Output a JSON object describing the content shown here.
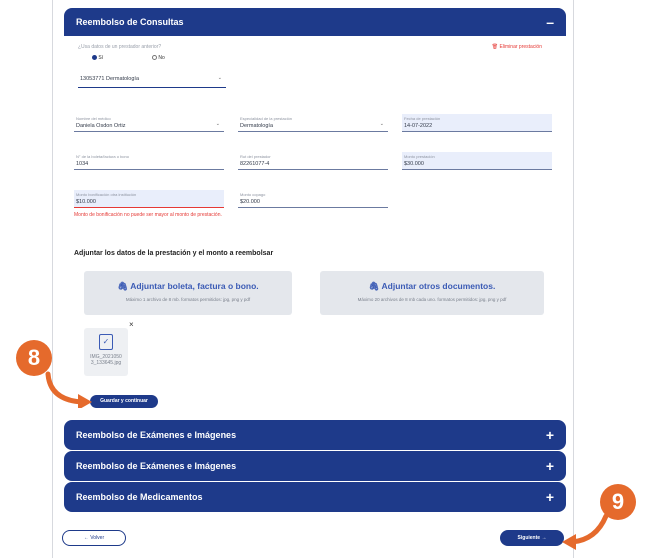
{
  "accordions": {
    "consultas": {
      "title": "Reembolso de Consultas",
      "sign": "–"
    },
    "examenes1": {
      "title": "Reembolso de Exámenes e Imágenes",
      "sign": "+"
    },
    "examenes2": {
      "title": "Reembolso de Exámenes e Imágenes",
      "sign": "+"
    },
    "medicamentos": {
      "title": "Reembolso de Medicamentos",
      "sign": "+"
    }
  },
  "form": {
    "question": "¿Usa datos de un prestador anterior?",
    "delete_link": "Eliminar prestación",
    "radio_yes": "Sí",
    "radio_no": "No",
    "prestador_select": "13053771 Dermatología",
    "fields": {
      "medico_label": "Nombre del médico",
      "medico_value": "Daniela Osdon Ortiz",
      "especialidad_label": "Especialidad de la prestación",
      "especialidad_value": "Dermatología",
      "fecha_label": "Fecha de prestación",
      "fecha_value": "14-07-2022",
      "boleta_label": "N° de la boleta/factura o bono",
      "boleta_value": "1034",
      "rut_label": "Rut del prestador",
      "rut_value": "82261077-4",
      "monto_label": "Monto prestación",
      "monto_value": "$30.000",
      "bonificacion_label": "Monto bonificación otra institución",
      "bonificacion_value": "$10.000",
      "copago_label": "Monto copago",
      "copago_value": "$20.000"
    },
    "error_text": "Monto de bonificación no puede ser mayor al monto de prestación."
  },
  "upload": {
    "section_title": "Adjuntar los datos de la prestación y el monto a reembolsar",
    "boleta_title": "Adjuntar boleta, factura o bono.",
    "boleta_sub": "Máximo 1 archivo de 8 mb. formatos permitidos: jpg, png y pdf",
    "otros_title": "Adjuntar otros documentos.",
    "otros_sub": "Máximo 20 archivos de 8 mb cada uno. formatos permitidos: jpg, png y pdf",
    "file_name_1": "IMG_2021050",
    "file_name_2": "3_133645.jpg",
    "remove": "×"
  },
  "buttons": {
    "save": "Guardar y continuar",
    "back": "← Volver",
    "next": "Siguiente →"
  },
  "callouts": {
    "eight": "8",
    "nine": "9"
  },
  "colors": {
    "primary": "#1e3a8a",
    "accent": "#e56a2c",
    "error": "#e53935"
  }
}
